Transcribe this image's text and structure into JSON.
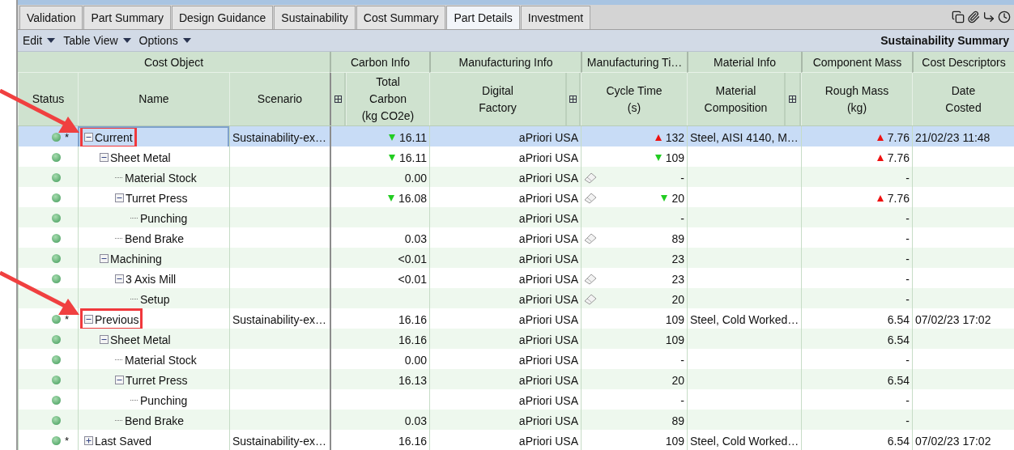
{
  "tabs": [
    {
      "label": "Validation",
      "selected": false
    },
    {
      "label": "Part Summary",
      "selected": false
    },
    {
      "label": "Design Guidance",
      "selected": false
    },
    {
      "label": "Sustainability",
      "selected": false
    },
    {
      "label": "Cost Summary",
      "selected": false
    },
    {
      "label": "Part Details",
      "selected": true
    },
    {
      "label": "Investment",
      "selected": false
    }
  ],
  "toolbar": {
    "menus": [
      "Edit",
      "Table View",
      "Options"
    ],
    "title": "Sustainability Summary"
  },
  "table": {
    "column_groups": [
      "Cost Object",
      "Carbon Info",
      "Manufacturing Info",
      "Manufacturing Ti…",
      "Material Info",
      "Component Mass",
      "Cost Descriptors"
    ],
    "columns": [
      {
        "kind": "label",
        "label": "Status"
      },
      {
        "kind": "label",
        "label": "Name"
      },
      {
        "kind": "label",
        "label": "Scenario"
      },
      {
        "kind": "expander"
      },
      {
        "kind": "label",
        "label": "Total\nCarbon\n(kg CO2e)"
      },
      {
        "kind": "label",
        "label": "Digital\nFactory"
      },
      {
        "kind": "expander"
      },
      {
        "kind": "label",
        "label": "Cycle Time\n(s)"
      },
      {
        "kind": "label",
        "label": "Material\nComposition"
      },
      {
        "kind": "expander"
      },
      {
        "kind": "label",
        "label": "Rough Mass\n(kg)"
      },
      {
        "kind": "label",
        "label": "Date\nCosted"
      }
    ],
    "rows": [
      {
        "name": "Current",
        "status_ok": true,
        "marker": "*",
        "scenario": "Sustainability-ex…",
        "expanded": true,
        "selected": true,
        "highlighted": true,
        "carbon": "16.11",
        "carbon_down": true,
        "factory": "aPriori USA",
        "cycle": "132",
        "cycle_up": true,
        "material": "Steel, AISI 4140, M…",
        "mass": "7.76",
        "mass_up": true,
        "date": "21/02/23 11:48",
        "children": [
          {
            "name": "Sheet Metal",
            "status_ok": true,
            "expanded": true,
            "selected": false,
            "carbon": "16.11",
            "carbon_down": true,
            "factory": "aPriori USA",
            "cycle": "109",
            "cycle_down": true,
            "mass": "7.76",
            "mass_up": true,
            "children": [
              {
                "name": "Material Stock",
                "status_ok": true,
                "selected": false,
                "carbon": "0.00",
                "factory": "aPriori USA",
                "note": true,
                "cycle": "-",
                "mass": "-"
              },
              {
                "name": "Turret Press",
                "status_ok": true,
                "expanded": true,
                "selected": false,
                "carbon": "16.08",
                "carbon_down": true,
                "factory": "aPriori USA",
                "note": true,
                "cycle": "20",
                "cycle_down": true,
                "mass": "7.76",
                "mass_up": true,
                "children": [
                  {
                    "name": "Punching",
                    "status_ok": true,
                    "selected": false,
                    "factory": "aPriori USA",
                    "cycle": "-",
                    "mass": "-"
                  }
                ]
              },
              {
                "name": "Bend Brake",
                "status_ok": true,
                "selected": false,
                "carbon": "0.03",
                "factory": "aPriori USA",
                "note": true,
                "cycle": "89",
                "mass": "-"
              }
            ]
          },
          {
            "name": "Machining",
            "status_ok": true,
            "expanded": true,
            "selected": false,
            "carbon": "<0.01",
            "factory": "aPriori USA",
            "cycle": "23",
            "mass": "-",
            "children": [
              {
                "name": "3 Axis Mill",
                "status_ok": true,
                "expanded": true,
                "selected": false,
                "carbon": "<0.01",
                "factory": "aPriori USA",
                "note": true,
                "cycle": "23",
                "mass": "-",
                "children": [
                  {
                    "name": "Setup",
                    "status_ok": false,
                    "selected": false,
                    "factory": "aPriori USA",
                    "note": true,
                    "cycle": "20",
                    "mass": "-"
                  }
                ]
              }
            ]
          }
        ]
      },
      {
        "name": "Previous",
        "status_ok": true,
        "marker": "*",
        "scenario": "Sustainability-ex…",
        "expanded": true,
        "selected": false,
        "highlighted": true,
        "carbon": "16.16",
        "factory": "aPriori USA",
        "cycle": "109",
        "material": "Steel, Cold Worked…",
        "mass": "6.54",
        "date": "07/02/23 17:02",
        "children": [
          {
            "name": "Sheet Metal",
            "status_ok": true,
            "expanded": true,
            "selected": false,
            "carbon": "16.16",
            "factory": "aPriori USA",
            "cycle": "109",
            "mass": "6.54",
            "children": [
              {
                "name": "Material Stock",
                "status_ok": true,
                "selected": false,
                "carbon": "0.00",
                "factory": "aPriori USA",
                "cycle": "-",
                "mass": "-"
              },
              {
                "name": "Turret Press",
                "status_ok": true,
                "expanded": true,
                "selected": false,
                "carbon": "16.13",
                "factory": "aPriori USA",
                "cycle": "20",
                "mass": "6.54",
                "children": [
                  {
                    "name": "Punching",
                    "status_ok": true,
                    "selected": false,
                    "factory": "aPriori USA",
                    "cycle": "-",
                    "mass": "-"
                  }
                ]
              },
              {
                "name": "Bend Brake",
                "status_ok": true,
                "selected": false,
                "carbon": "0.03",
                "factory": "aPriori USA",
                "cycle": "89",
                "mass": "-"
              }
            ]
          }
        ]
      },
      {
        "name": "Last Saved",
        "status_ok": true,
        "marker": "*",
        "scenario": "Sustainability-ex…",
        "expanded": false,
        "selected": false,
        "carbon": "16.16",
        "factory": "aPriori USA",
        "cycle": "109",
        "material": "Steel, Cold Worked…",
        "mass": "6.54",
        "date": "07/02/23 17:02"
      }
    ]
  }
}
